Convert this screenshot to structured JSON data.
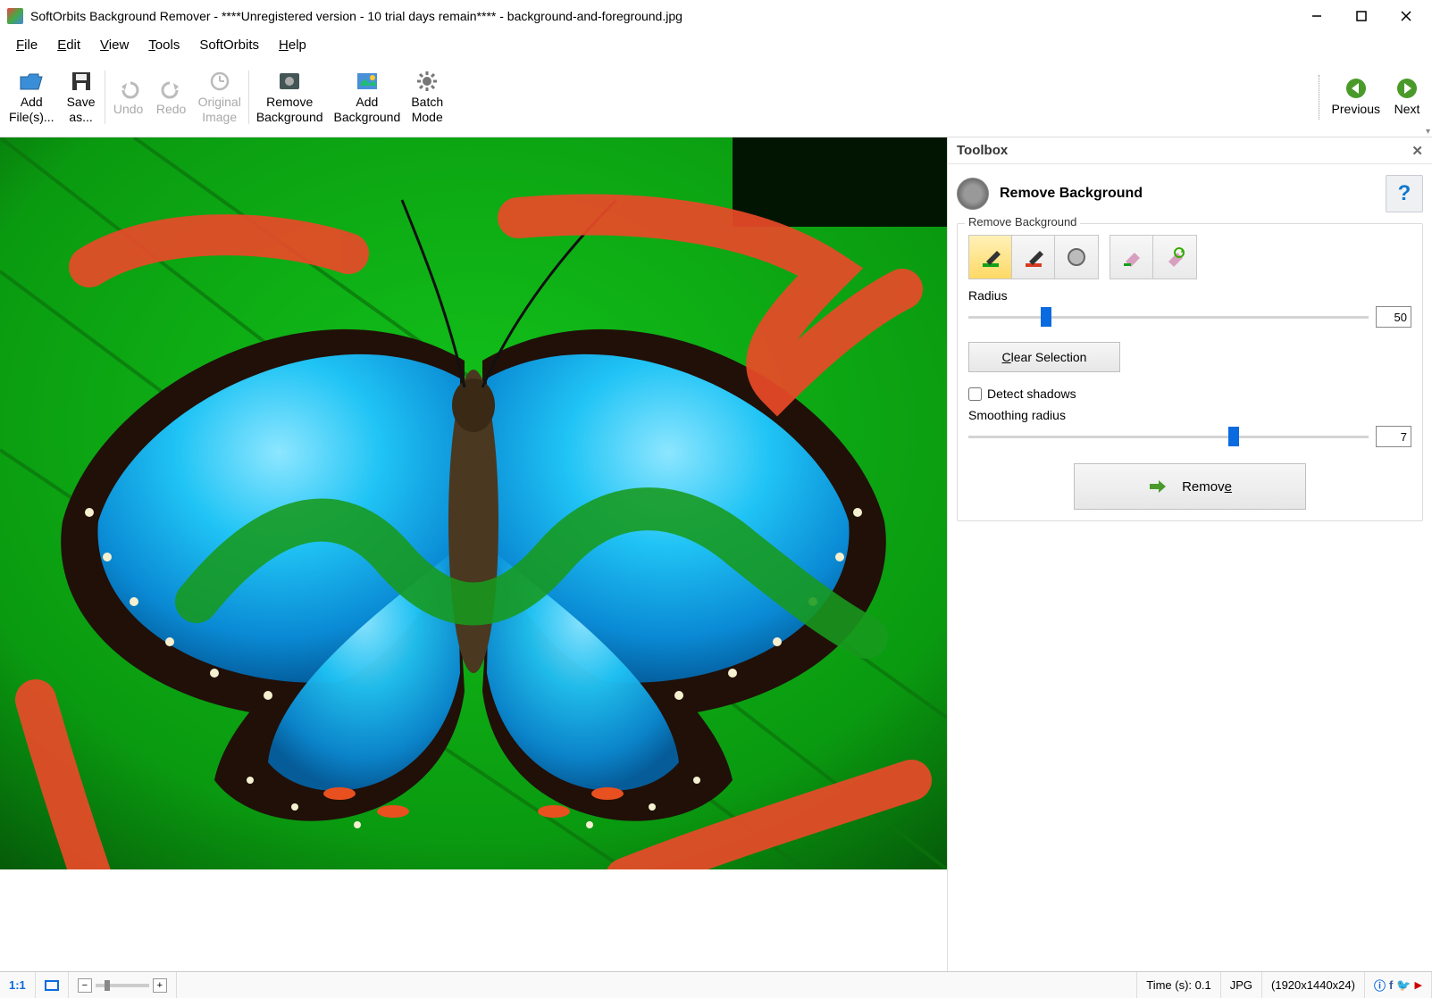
{
  "window": {
    "title": "SoftOrbits Background Remover - ****Unregistered version - 10 trial days remain**** - background-and-foreground.jpg"
  },
  "menu": {
    "file": "File",
    "edit": "Edit",
    "view": "View",
    "tools": "Tools",
    "softorbits": "SoftOrbits",
    "help": "Help"
  },
  "toolbar": {
    "add_files": "Add\nFile(s)...",
    "save_as": "Save\nas...",
    "undo": "Undo",
    "redo": "Redo",
    "original_image": "Original\nImage",
    "remove_bg": "Remove\nBackground",
    "add_bg": "Add\nBackground",
    "batch": "Batch\nMode",
    "previous": "Previous",
    "next": "Next"
  },
  "toolbox": {
    "panel_title": "Toolbox",
    "section_title": "Remove Background",
    "group_label": "Remove Background",
    "radius_label": "Radius",
    "radius_value": "50",
    "clear_selection": "Clear Selection",
    "detect_shadows": "Detect shadows",
    "smoothing_label": "Smoothing radius",
    "smoothing_value": "7",
    "remove": "Remove"
  },
  "status": {
    "ratio": "1:1",
    "time": "Time (s): 0.1",
    "format": "JPG",
    "dimensions": "(1920x1440x24)"
  }
}
